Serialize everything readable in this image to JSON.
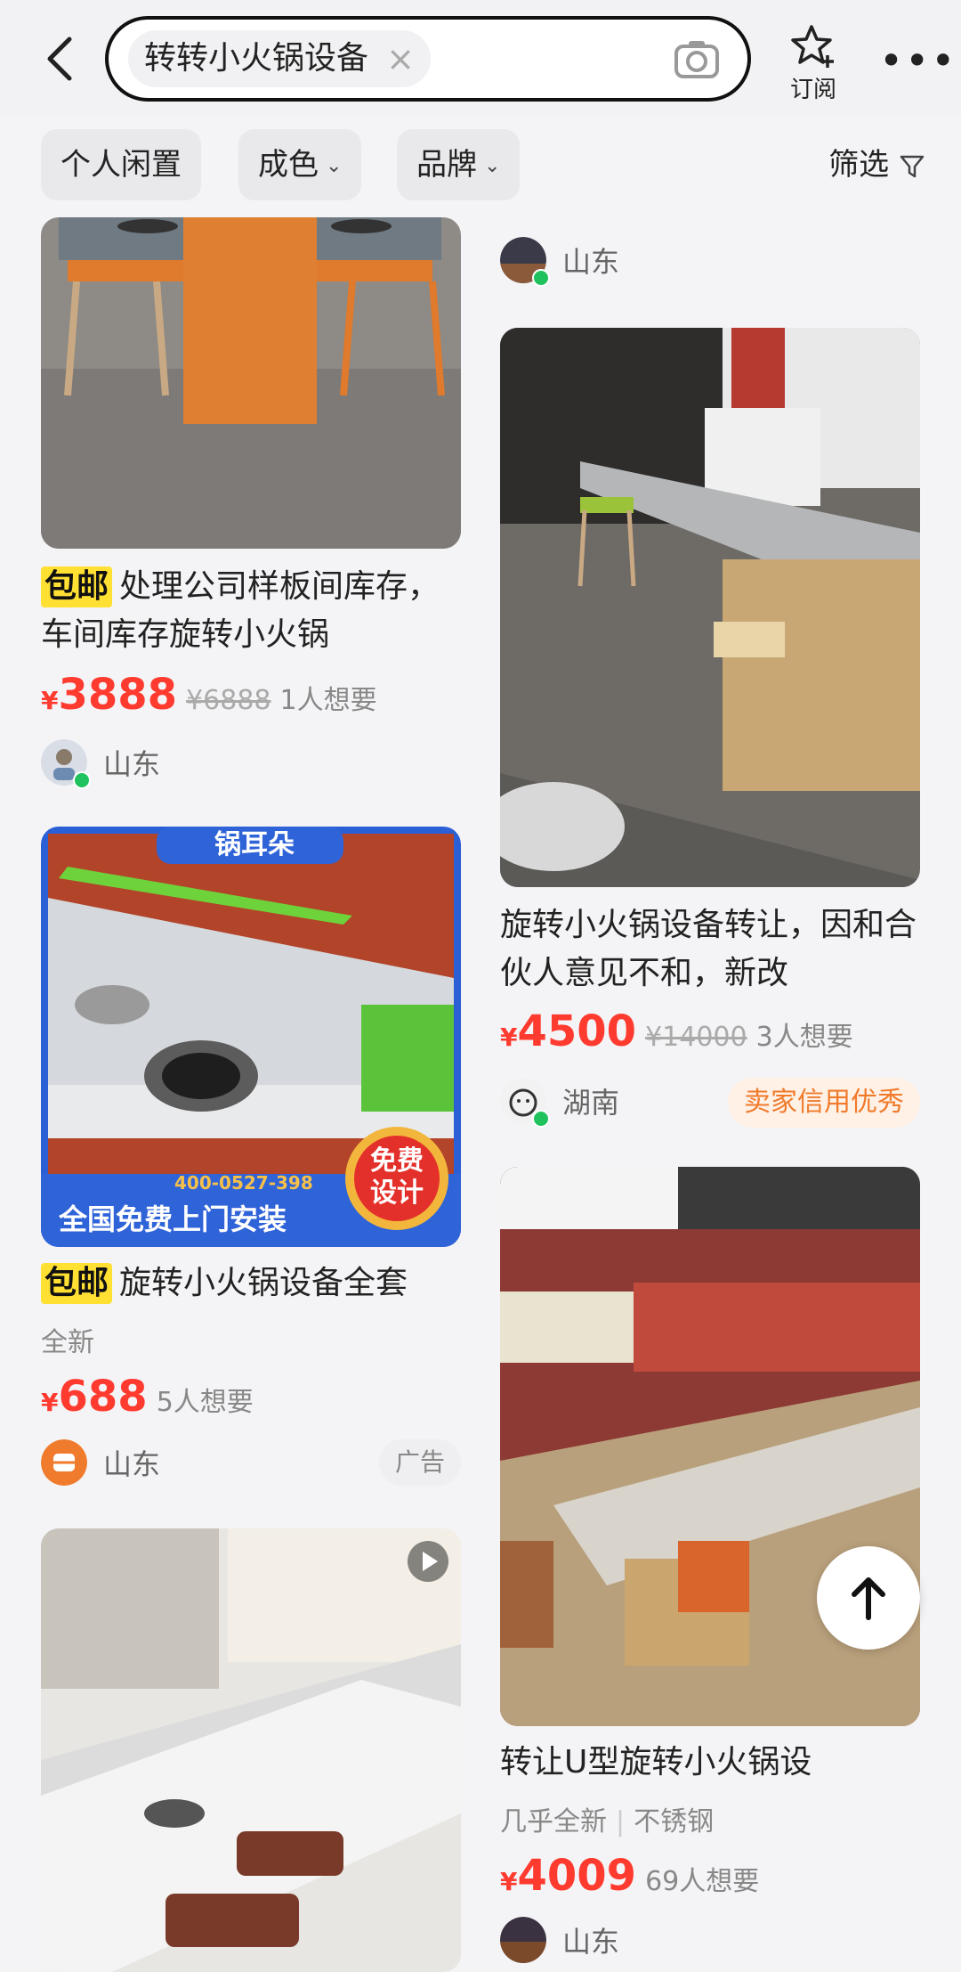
{
  "header": {
    "search_query": "转转小火锅设备",
    "subscribe_label": "订阅",
    "more_label": "•••"
  },
  "filters": {
    "items": [
      {
        "label": "个人闲置",
        "has_chevron": false
      },
      {
        "label": "成色",
        "has_chevron": true
      },
      {
        "label": "品牌",
        "has_chevron": true
      }
    ],
    "screen_label": "筛选"
  },
  "left_column": [
    {
      "shipping_badge": "包邮",
      "title": "处理公司样板间库存，车间库存旋转小火锅",
      "price_symbol": "¥",
      "price": "3888",
      "original_price": "¥6888",
      "wants": "1人想要",
      "location": "山东",
      "image_icon": "table-photo"
    },
    {
      "shipping_badge": "包邮",
      "title": "旋转小火锅设备全套",
      "condition": "全新",
      "price_symbol": "¥",
      "price": "688",
      "wants": "5人想要",
      "location": "山东",
      "ad_label": "广告",
      "ad_image_text": {
        "brand": "锅耳朵",
        "phone": "400-0527-398",
        "banner": "全国免费上门安装",
        "stamp_line1": "免费",
        "stamp_line2": "设计"
      }
    },
    {
      "image_icon": "video-play-icon"
    }
  ],
  "right_column": [
    {
      "location": "山东"
    },
    {
      "title": "旋转小火锅设备转让，因和合伙人意见不和，新改",
      "price_symbol": "¥",
      "price": "4500",
      "original_price": "¥14000",
      "wants": "3人想要",
      "location": "湖南",
      "credit_badge": "卖家信用优秀"
    },
    {
      "title": "转让U型旋转小火锅设",
      "condition": "几乎全新",
      "material": "不锈钢",
      "price_symbol": "¥",
      "price": "4009",
      "wants": "69人想要",
      "location": "山东"
    }
  ],
  "colors": {
    "price_red": "#ff3b30",
    "online_green": "#1fc25c",
    "badge_yellow": "#ffe033",
    "credit_orange": "#f07b2c"
  }
}
